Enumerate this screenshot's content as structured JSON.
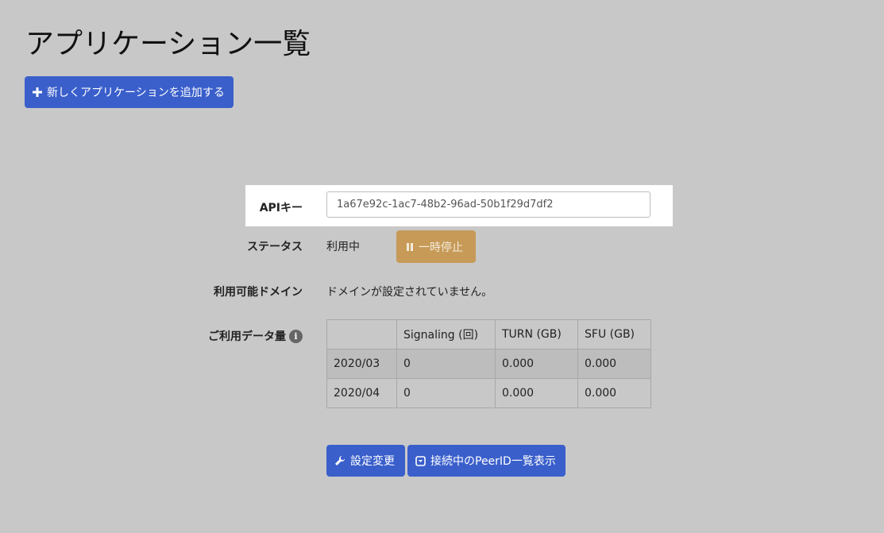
{
  "page": {
    "title": "アプリケーション一覧",
    "add_button_label": "新しくアプリケーションを追加する"
  },
  "app": {
    "api_key_label": "APIキー",
    "api_key_value": "1a67e92c-1ac7-48b2-96ad-50b1f29d7df2",
    "status_label": "ステータス",
    "status_value": "利用中",
    "pause_button_label": "一時停止",
    "domains_label": "利用可能ドメイン",
    "domains_value": "ドメインが設定されていません。",
    "usage_label": "ご利用データ量",
    "usage_table": {
      "headers": [
        "",
        "Signaling (回)",
        "TURN (GB)",
        "SFU (GB)"
      ],
      "rows": [
        [
          "2020/03",
          "0",
          "0.000",
          "0.000"
        ],
        [
          "2020/04",
          "0",
          "0.000",
          "0.000"
        ]
      ]
    },
    "settings_button_label": "設定変更",
    "peer_list_button_label": "接続中のPeerID一覧表示"
  },
  "icons": {
    "add": "plus-icon",
    "pause": "pause-icon",
    "settings": "wrench-icon",
    "peer_list": "dropdown-box-icon",
    "usage_info": "info-icon"
  },
  "colors": {
    "background": "#c8c8c8",
    "primary_button": "#3a5fcb",
    "pause_button": "#c79a58",
    "highlight_row": "#ffffff"
  }
}
